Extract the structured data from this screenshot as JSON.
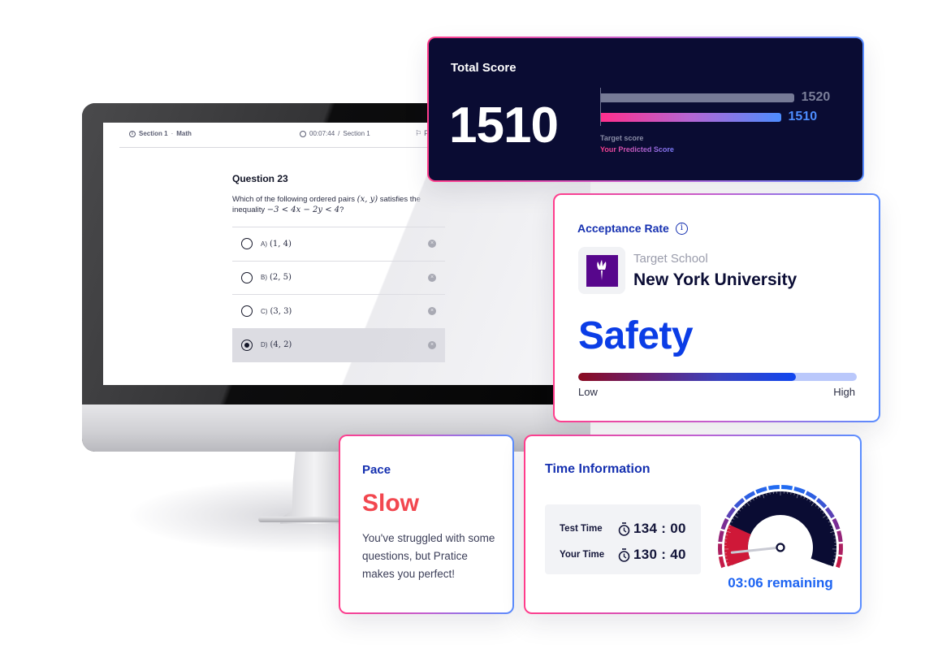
{
  "exam_screen": {
    "header": {
      "section_label": "Section 1",
      "subject": "Math",
      "timer": "00:07:44",
      "timer_section": "Section 1",
      "flag_label": "F"
    },
    "question": {
      "title": "Question 23",
      "text_prefix": "Which of the following ordered pairs",
      "text_vars": "(x, y)",
      "text_mid": "satisfies the inequality",
      "text_inequality": "−3 < 4x − 2y < 4",
      "text_suffix": "?",
      "options": [
        {
          "letter": "A)",
          "value": "(1, 4)",
          "selected": false
        },
        {
          "letter": "B)",
          "value": "(2, 5)",
          "selected": false
        },
        {
          "letter": "C)",
          "value": "(3, 3)",
          "selected": false
        },
        {
          "letter": "D)",
          "value": "(4, 2)",
          "selected": true
        }
      ]
    }
  },
  "total_score": {
    "title": "Total Score",
    "score": "1510",
    "target_value": 1520,
    "predicted_value": 1510,
    "target_label": "1520",
    "predicted_label": "1510",
    "legend_target": "Target score",
    "legend_predicted": "Your Predicted Score"
  },
  "acceptance": {
    "title": "Acceptance Rate",
    "school_label": "Target School",
    "school_name": "New York University",
    "status": "Safety",
    "level_fraction": 0.78,
    "low_label": "Low",
    "high_label": "High",
    "colors": {
      "status": "#0b3de6",
      "logo_bg": "#57068c"
    }
  },
  "pace": {
    "title": "Pace",
    "value": "Slow",
    "description": "You've struggled with some questions, but Pratice makes you perfect!",
    "colors": {
      "value": "#f2474f"
    }
  },
  "time_info": {
    "title": "Time Information",
    "rows": [
      {
        "label": "Test Time",
        "value": "134 : 00"
      },
      {
        "label": "Your Time",
        "value": "130 : 40"
      }
    ],
    "gauge_fraction_used": 0.975,
    "remaining": "03:06 remaining"
  }
}
